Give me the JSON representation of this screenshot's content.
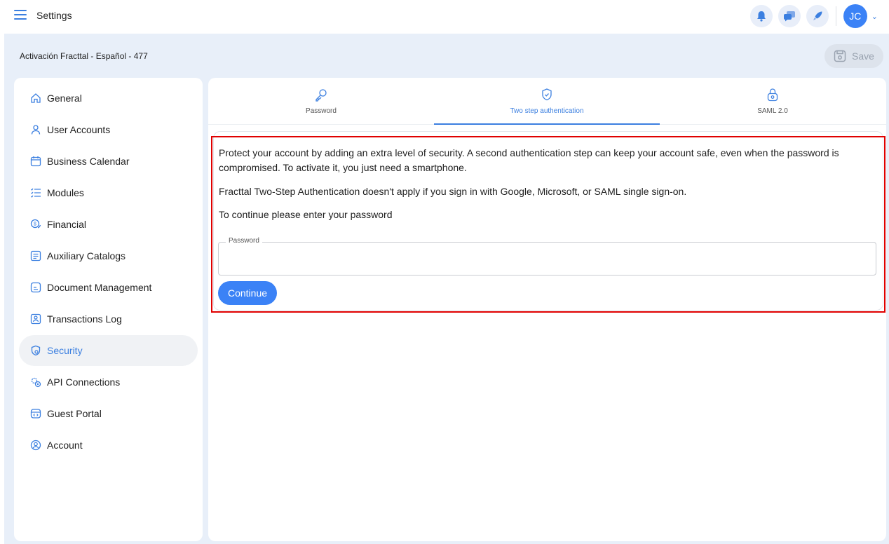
{
  "topbar": {
    "title": "Settings",
    "avatar_initials": "JC"
  },
  "context": {
    "title": "Activación Fracttal - Español - 477",
    "save_label": "Save"
  },
  "sidebar": {
    "items": [
      {
        "label": "General",
        "icon": "home-icon"
      },
      {
        "label": "User Accounts",
        "icon": "user-icon"
      },
      {
        "label": "Business Calendar",
        "icon": "calendar-icon"
      },
      {
        "label": "Modules",
        "icon": "list-icon"
      },
      {
        "label": "Financial",
        "icon": "coin-icon"
      },
      {
        "label": "Auxiliary Catalogs",
        "icon": "catalog-icon"
      },
      {
        "label": "Document Management",
        "icon": "document-icon"
      },
      {
        "label": "Transactions Log",
        "icon": "log-icon"
      },
      {
        "label": "Security",
        "icon": "shield-icon",
        "active": true
      },
      {
        "label": "API Connections",
        "icon": "api-gear-icon"
      },
      {
        "label": "Guest Portal",
        "icon": "portal-icon"
      },
      {
        "label": "Account",
        "icon": "account-icon"
      }
    ]
  },
  "tabs": [
    {
      "label": "Password",
      "icon": "key-icon"
    },
    {
      "label": "Two step authentication",
      "icon": "shield-check-icon",
      "active": true
    },
    {
      "label": "SAML 2.0",
      "icon": "lock-icon"
    }
  ],
  "content": {
    "paragraph1": "Protect your account by adding an extra level of security. A second authentication step can keep your account safe, even when the password is compromised. To activate it, you just need a smartphone.",
    "paragraph2": "Fracttal Two-Step Authentication doesn't apply if you sign in with Google, Microsoft, or SAML single sign-on.",
    "paragraph3": "To continue please enter your password",
    "password_label": "Password",
    "password_value": "",
    "continue_label": "Continue"
  },
  "colors": {
    "accent": "#3b82f6",
    "background": "#e8eff9",
    "highlight": "#e00000"
  }
}
